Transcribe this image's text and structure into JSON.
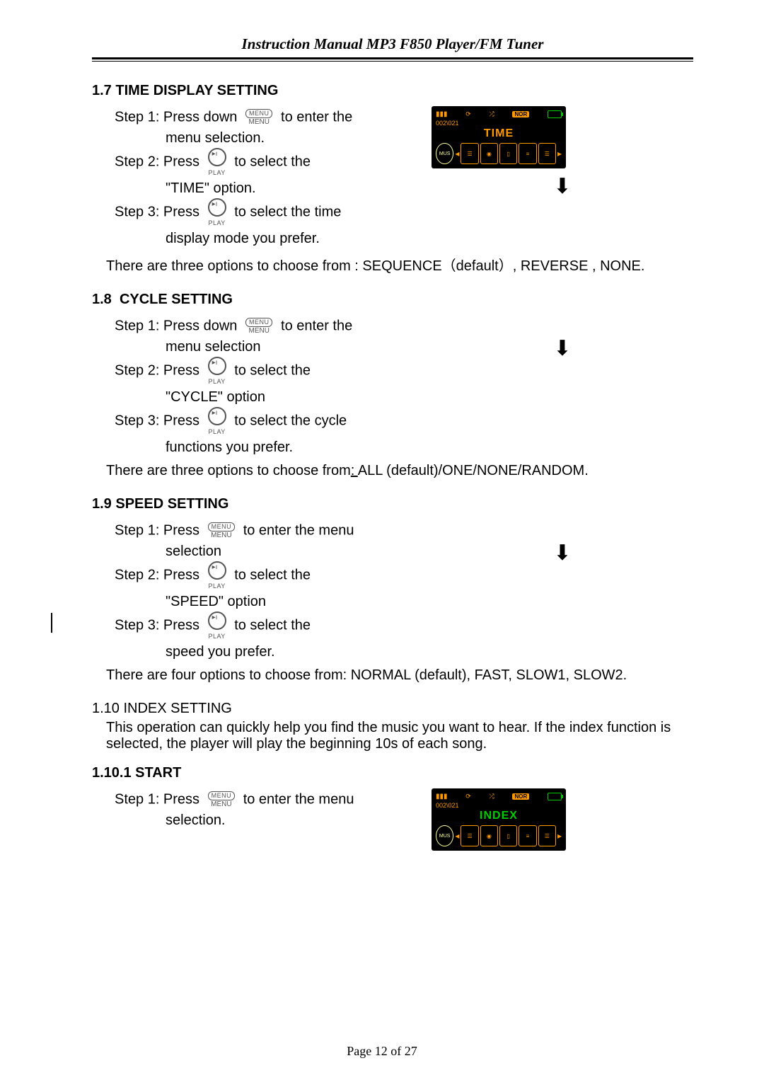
{
  "header": "Instruction Manual MP3 F850 Player/FM Tuner",
  "buttons": {
    "menu_label": "MENU",
    "menu_caption": "MENU",
    "play_caption": "PLAY"
  },
  "sec17": {
    "title_num": "1.7",
    "title_text": "TIME DISPLAY SETTING",
    "step1a": "Step 1: Press down ",
    "step1b": " to enter the",
    "step1c": "menu selection.",
    "step2a": "Step  2:  Press ",
    "step2b": " to  select  the",
    "step2c": "\"TIME\" option.",
    "step3a": "Step 3: Press ",
    "step3b": " to select the time",
    "step3c": "display mode you prefer.",
    "opts": "There are three options to choose from :   SEQUENCE（default）, REVERSE , NONE."
  },
  "sec18": {
    "title_num": "1.8",
    "title_text": "CYCLE SETTING",
    "step1a": "Step 1: Press down ",
    "step1b": " to enter the",
    "step1c": "menu selection",
    "step2a": "Step  2:  Press ",
    "step2b": " to  select  the",
    "step2c": "\"CYCLE\" option",
    "step3a": "Step 3: Press ",
    "step3b": " to select the cycle",
    "step3c": "functions you prefer.",
    "opts_a": "There are three options to choose from",
    "opts_b": ": ",
    "opts_c": "ALL (default)/ONE/NONE/RANDOM."
  },
  "sec19": {
    "title_num": "1.9",
    "title_text": "SPEED SETTING",
    "step1a": "Step 1: Press ",
    "step1b": " to enter the menu",
    "step1c": "selection",
    "step2a": "Step  2:  Press ",
    "step2b": " to  select  the",
    "step2c": "\"SPEED\" option",
    "step3a": "Step  3:  Press ",
    "step3b": " to  select  the",
    "step3c": "speed you prefer.",
    "opts": "There are four options to choose from: NORMAL (default), FAST, SLOW1, SLOW2."
  },
  "sec110": {
    "title": "1.10 INDEX SETTING",
    "body": "This operation can quickly help you find the music you want to hear. If the index function is selected, the player will play the beginning 10s of each song."
  },
  "sec1101": {
    "title": "1.10.1 START",
    "step1a": "Step 1: Press ",
    "step1b": " to enter the menu",
    "step1c": "selection."
  },
  "device": {
    "time": "002\\021",
    "nor": "NOR",
    "title_time": "TIME",
    "title_index": "INDEX",
    "icon_mus": "MUS",
    "arrow": "⬇"
  },
  "footer": "Page  12  of  27"
}
